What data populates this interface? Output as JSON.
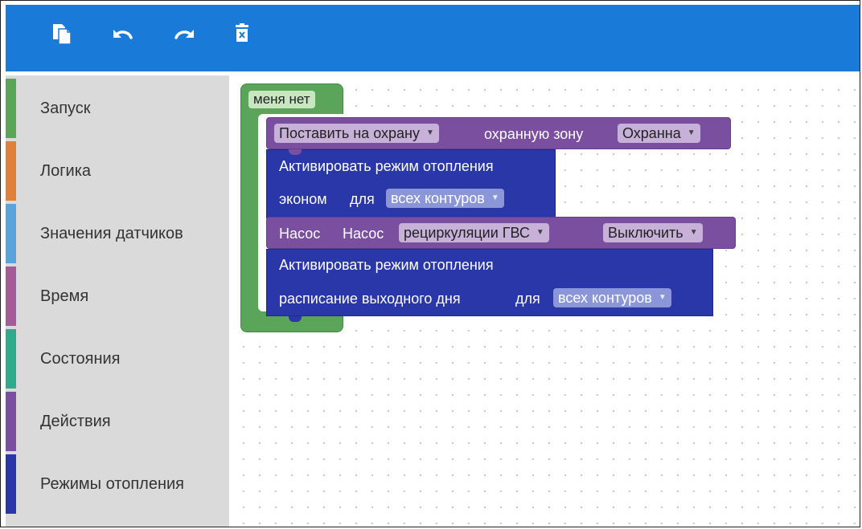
{
  "toolbar": {
    "buttons": [
      {
        "name": "copy",
        "icon": "copy-icon"
      },
      {
        "name": "undo",
        "icon": "undo-icon"
      },
      {
        "name": "redo",
        "icon": "redo-icon"
      },
      {
        "name": "delete",
        "icon": "trash-icon"
      }
    ]
  },
  "sidebar": {
    "categories": [
      {
        "label": "Запуск",
        "color": "#5ba55a"
      },
      {
        "label": "Логика",
        "color": "#e0813a"
      },
      {
        "label": "Значения датчиков",
        "color": "#5aa3dc"
      },
      {
        "label": "Время",
        "color": "#a55b96"
      },
      {
        "label": "Состояния",
        "color": "#2eab8a"
      },
      {
        "label": "Действия",
        "color": "#7b4fa0"
      },
      {
        "label": "Режимы отопления",
        "color": "#2a37a8"
      }
    ]
  },
  "workspace": {
    "container": {
      "label": "меня нет"
    },
    "arm_block": {
      "action": "Поставить на охрану",
      "text": "охранную зону",
      "zone": "Охранна"
    },
    "heating_block_1": {
      "line1": "Активировать режим отопления",
      "mode": "эконом",
      "for": "для",
      "circuits": "всех контуров"
    },
    "pump_block": {
      "label1": "Насос",
      "label2": "Насос",
      "pump": "рециркуляции ГВС",
      "state": "Выключить"
    },
    "heating_block_2": {
      "line1": "Активировать режим отопления",
      "mode": "расписание выходного дня",
      "for": "для",
      "circuits": "всех контуров"
    }
  },
  "colors": {
    "toolbar": "#1a7ad8",
    "green": "#5ba55a",
    "purple": "#7b4fa0",
    "navy": "#2a37a8"
  }
}
